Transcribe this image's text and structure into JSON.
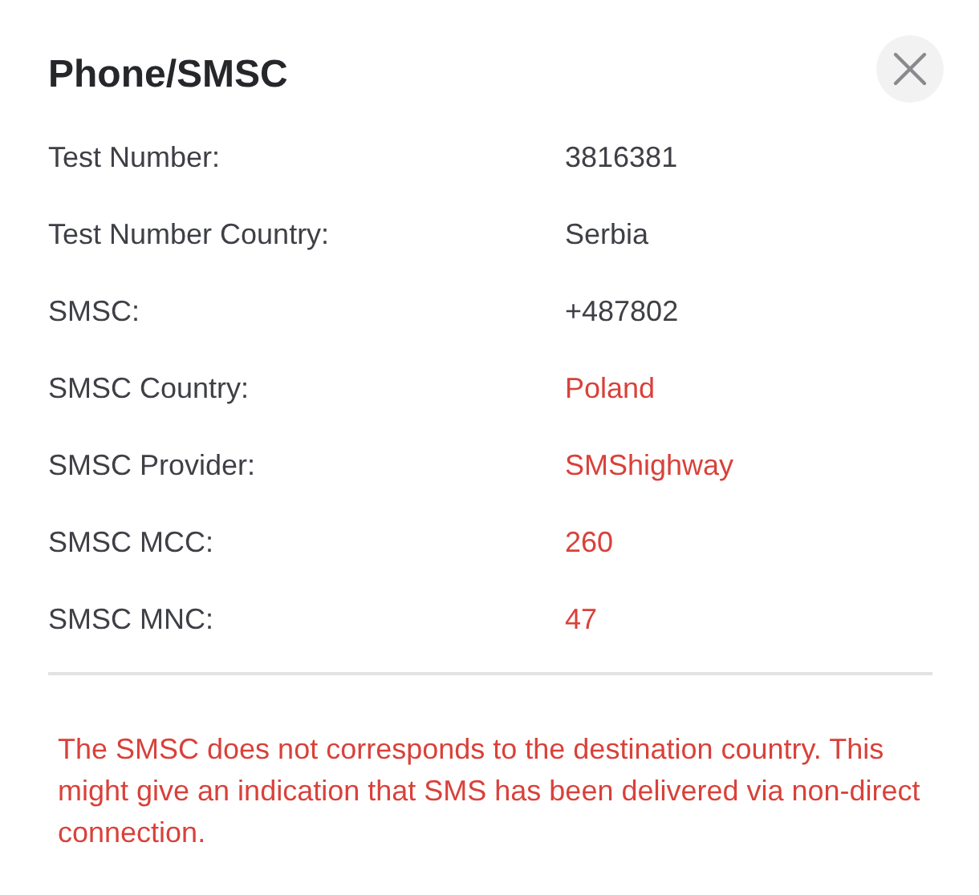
{
  "dialog": {
    "title": "Phone/SMSC"
  },
  "fields": [
    {
      "label": "Test Number:",
      "value": "3816381",
      "highlighted": false
    },
    {
      "label": "Test Number Country:",
      "value": "Serbia",
      "highlighted": false
    },
    {
      "label": "SMSC:",
      "value": "+487802",
      "highlighted": false
    },
    {
      "label": "SMSC Country:",
      "value": "Poland",
      "highlighted": true
    },
    {
      "label": "SMSC Provider:",
      "value": "SMShighway",
      "highlighted": true
    },
    {
      "label": "SMSC MCC:",
      "value": "260",
      "highlighted": true
    },
    {
      "label": "SMSC MNC:",
      "value": "47",
      "highlighted": true
    }
  ],
  "warning": "The SMSC does not corresponds to the destination country. This might give an indication that SMS has been delivered via non-direct connection."
}
